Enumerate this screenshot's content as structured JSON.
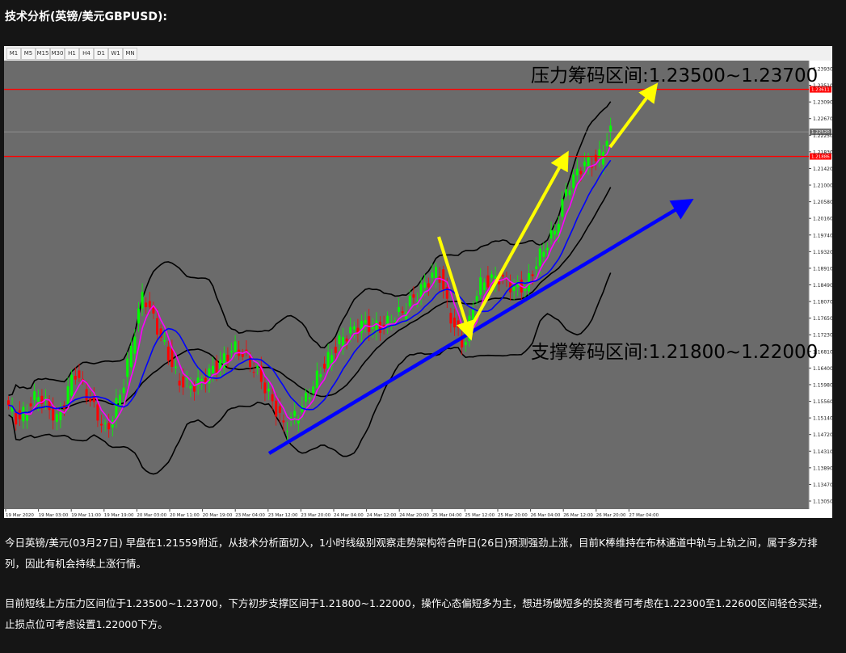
{
  "heading": "技术分析(英镑/美元GBPUSD):",
  "timeframes": [
    "M1",
    "M5",
    "M15",
    "M30",
    "H1",
    "H4",
    "D1",
    "W1",
    "MN"
  ],
  "chart_data": {
    "type": "candlestick",
    "y_ticks": [
      "1.23930",
      "1.23510",
      "1.23090",
      "1.22670",
      "1.22250",
      "1.21830",
      "1.21420",
      "1.21000",
      "1.20580",
      "1.20160",
      "1.19740",
      "1.19320",
      "1.18910",
      "1.18490",
      "1.18070",
      "1.17650",
      "1.17230",
      "1.16810",
      "1.16400",
      "1.15980",
      "1.15560",
      "1.15140",
      "1.14720",
      "1.14310",
      "1.13890",
      "1.13470",
      "1.13050"
    ],
    "x_ticks": [
      "19 Mar 2020",
      "19 Mar 03:00",
      "19 Mar 11:00",
      "19 Mar 19:00",
      "20 Mar 03:00",
      "20 Mar 11:00",
      "20 Mar 19:00",
      "23 Mar 04:00",
      "23 Mar 12:00",
      "23 Mar 20:00",
      "24 Mar 04:00",
      "24 Mar 12:00",
      "24 Mar 20:00",
      "25 Mar 04:00",
      "25 Mar 12:00",
      "25 Mar 20:00",
      "26 Mar 04:00",
      "26 Mar 12:00",
      "26 Mar 20:00",
      "27 Mar 04:00"
    ],
    "ylim": [
      1.1305,
      1.2414
    ],
    "price_labels": {
      "resistance": "1.23611",
      "current": "1.22520",
      "support": "1.21886"
    },
    "resistance_level": 1.2361,
    "support_level": 1.2189,
    "current_level": 1.2252,
    "colors": {
      "up": "#00ff00",
      "down": "#ff0000",
      "ma_fast": "#0000ff",
      "ma_slow": "#ff00ff",
      "bands": "#000000",
      "level": "#ff0000"
    },
    "annotations": {
      "resistance_text": "压力筹码区间:1.23500~1.23700",
      "support_text": "支撑筹码区间:1.21800~1.22000"
    }
  },
  "paragraphs": [
    "今日英镑/美元(03月27日) 早盘在1.21559附近，从技术分析面切入，1小时线级别观察走势架构符合昨日(26日)预测强劲上涨，目前K棒维持在布林通道中轨与上轨之间，属于多方排列，因此有机会持续上涨行情。",
    "目前短线上方压力区间位于1.23500~1.23700，下方初步支撑区间于1.21800~1.22000，操作心态偏短多为主，想进场做短多的投资者可考虑在1.22300至1.22600区间轻仓买进，止损点位可考虑设置1.22000下方。"
  ]
}
